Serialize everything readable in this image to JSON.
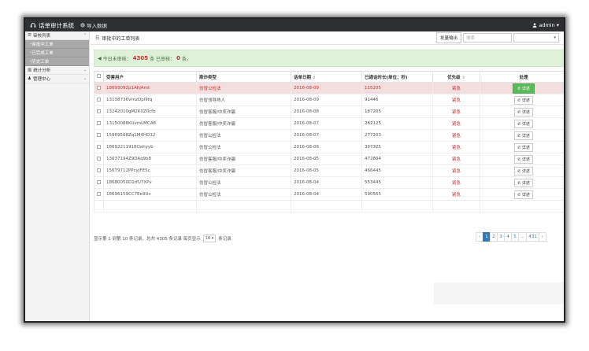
{
  "topbar": {
    "brand": "话单审计系统",
    "import_label": "导入数据",
    "user": "admin"
  },
  "sidebar": {
    "groups": [
      {
        "label": "审核列表",
        "subitems": [
          "审批中工单",
          "已完成工单",
          "历史工单"
        ]
      },
      {
        "label": "统计分析"
      },
      {
        "label": "管理中心"
      }
    ]
  },
  "panel": {
    "title": "审批中的工单列表",
    "export_label": "批量输出",
    "search_placeholder": "搜索"
  },
  "alert": {
    "prefix": "今日未审核：",
    "pending_count": "4305",
    "middle": "条 已审核：",
    "done_count": "0",
    "suffix": "条。"
  },
  "table": {
    "headers": [
      "受害用户",
      "欺诈类型",
      "话单日期",
      "已通话时长(单位：秒)",
      "优先级",
      "处理"
    ],
    "detail_label": "详述",
    "rows": [
      {
        "user": "18693092p1AhJAmt",
        "type": "仿冒公检法",
        "date": "2016-08-09",
        "duration": "115205",
        "priority": "紧急",
        "highlight": true
      },
      {
        "user": "13138736VmzDpl9fq",
        "type": "仿冒领导熟人",
        "date": "2016-08-09",
        "duration": "91446",
        "priority": "紧急"
      },
      {
        "user": "13242010gM2K0Z0cfb",
        "type": "仿冒客服/中奖诈骗",
        "date": "2016-08-08",
        "duration": "187205",
        "priority": "紧急"
      },
      {
        "user": "13150088KUvmLMCA8",
        "type": "仿冒客服/中奖诈骗",
        "date": "2016-08-07",
        "duration": "282125",
        "priority": "紧急"
      },
      {
        "user": "15969508Zq1M4HD12",
        "type": "仿冒公检法",
        "date": "2016-08-07",
        "duration": "277203",
        "priority": "紧急"
      },
      {
        "user": "18692211918Oahyyb",
        "type": "仿冒公检法",
        "date": "2016-08-06",
        "duration": "367325",
        "priority": "紧急"
      },
      {
        "user": "13037194Z9DAq9b8",
        "type": "仿冒客服/中奖诈骗",
        "date": "2016-08-05",
        "duration": "472804",
        "priority": "紧急"
      },
      {
        "user": "15679712PPcyjFE5c",
        "type": "仿冒客服/中奖诈骗",
        "date": "2016-08-05",
        "duration": "466445",
        "priority": "紧急"
      },
      {
        "user": "18680050D1tfU7XPv",
        "type": "仿冒公检法",
        "date": "2016-08-04",
        "duration": "553445",
        "priority": "紧急"
      },
      {
        "user": "18696159CC7Ee9Uc",
        "type": "仿冒公检法",
        "date": "2016-08-04",
        "duration": "590565",
        "priority": "紧急"
      }
    ]
  },
  "footer": {
    "summary": "显示第 1 到第 10 条记录，总共 4305 条记录 每页显示",
    "page_size": "10",
    "per_page_suffix": "条记录"
  },
  "pagination": [
    "‹",
    "1",
    "2",
    "3",
    "4",
    "5",
    "...",
    "431",
    "›"
  ],
  "colors": {
    "topbar": "#2d2f33",
    "alert_bg": "#dff0d8",
    "highlight_row": "#f2dede",
    "urgent": "#c9302c",
    "primary": "#337ab7",
    "success": "#5cb85c"
  }
}
